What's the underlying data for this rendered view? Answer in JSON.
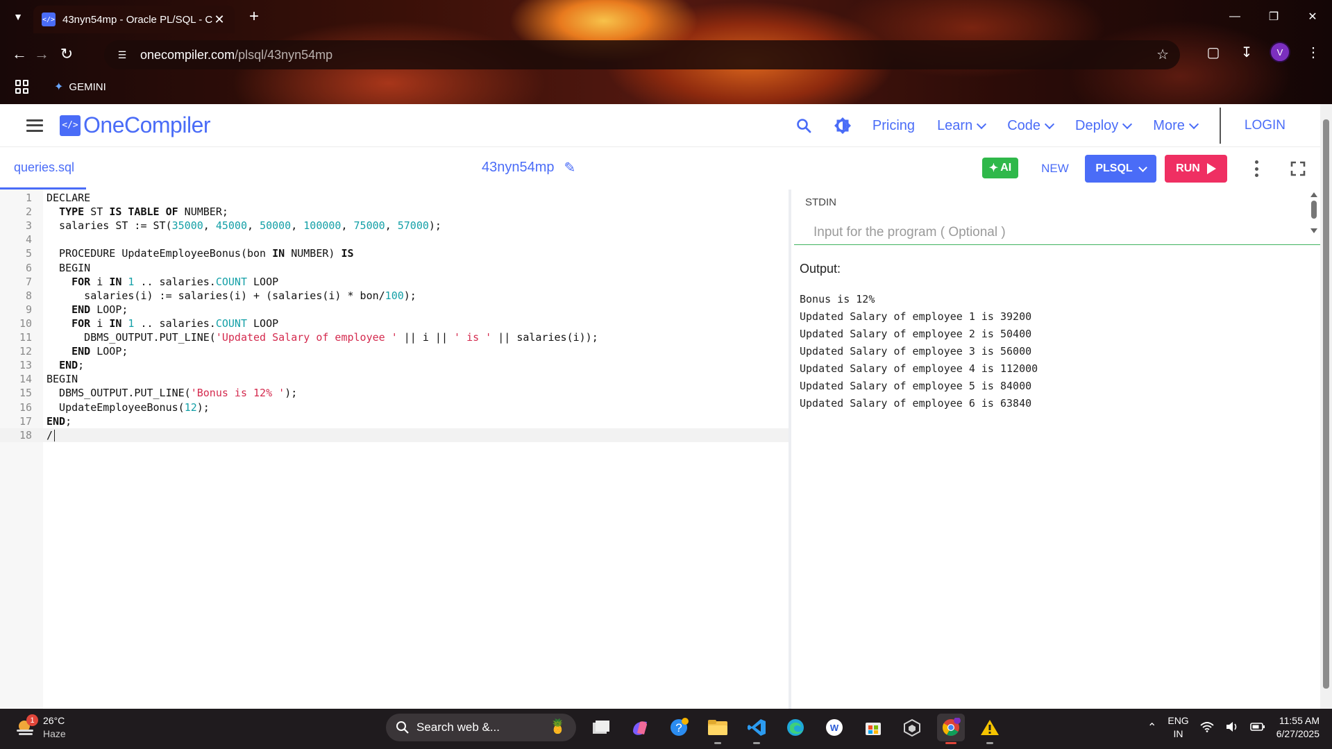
{
  "browser": {
    "tab_title": "43nyn54mp - Oracle PL/SQL - C",
    "url_host": "onecompiler.com",
    "url_path": "/plsql/43nyn54mp",
    "bookmark_label": "GEMINI",
    "profile_initial": "V"
  },
  "header": {
    "logo_text": "OneCompiler",
    "nav": [
      "Pricing",
      "Learn",
      "Code",
      "Deploy",
      "More"
    ],
    "login": "LOGIN"
  },
  "toolbar": {
    "file_name": "queries.sql",
    "doc_name": "43nyn54mp",
    "ai_label": "AI",
    "new_label": "NEW",
    "language": "PLSQL",
    "run_label": "RUN"
  },
  "editor": {
    "active_line": 18,
    "lines": [
      "DECLARE",
      "  TYPE ST IS TABLE OF NUMBER;",
      "  salaries ST := ST(35000, 45000, 50000, 100000, 75000, 57000);",
      "",
      "  PROCEDURE UpdateEmployeeBonus(bon IN NUMBER) IS",
      "  BEGIN",
      "    FOR i IN 1 .. salaries.COUNT LOOP",
      "      salaries(i) := salaries(i) + (salaries(i) * bon/100);",
      "    END LOOP;",
      "    FOR i IN 1 .. salaries.COUNT LOOP",
      "      DBMS_OUTPUT.PUT_LINE('Updated Salary of employee ' || i || ' is ' || salaries(i));",
      "    END LOOP;",
      "  END;",
      "BEGIN",
      "  DBMS_OUTPUT.PUT_LINE('Bonus is 12% ');",
      "  UpdateEmployeeBonus(12);",
      "END;",
      "/"
    ]
  },
  "io": {
    "stdin_label": "STDIN",
    "stdin_placeholder": "Input for the program ( Optional )",
    "output_label": "Output:",
    "output_lines": [
      "Bonus is 12%",
      "Updated Salary of employee 1 is 39200",
      "Updated Salary of employee 2 is 50400",
      "Updated Salary of employee 3 is 56000",
      "Updated Salary of employee 4 is 112000",
      "Updated Salary of employee 5 is 84000",
      "Updated Salary of employee 6 is 63840"
    ]
  },
  "taskbar": {
    "weather_badge": "1",
    "temperature": "26°C",
    "condition": "Haze",
    "search_placeholder": "Search web &...",
    "lang_top": "ENG",
    "lang_bottom": "IN",
    "time": "11:55 AM",
    "date": "6/27/2025"
  },
  "colors": {
    "brand": "#4a6cf7",
    "run": "#ef2f62",
    "ai": "#2fb84a",
    "number": "#14a0a7",
    "string": "#d42a4e"
  }
}
